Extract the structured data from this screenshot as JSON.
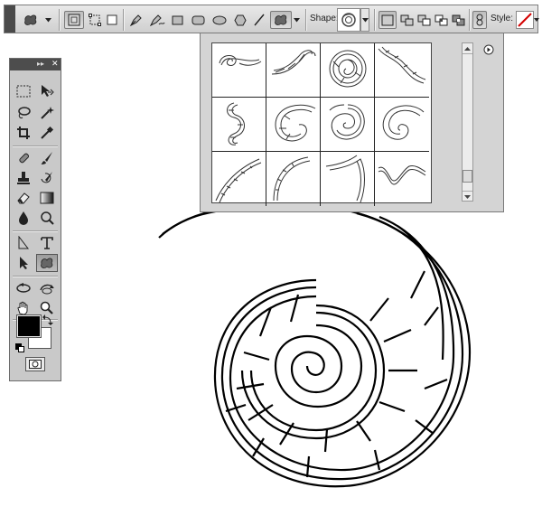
{
  "options_bar": {
    "shape_label": "Shape:",
    "style_label": "Style:",
    "tools": [
      "custom-shape-tool-preset",
      "shape-layers",
      "paths",
      "fill-pixels",
      "pen",
      "freeform-pen",
      "rectangle",
      "rounded-rectangle",
      "ellipse",
      "polygon",
      "line",
      "custom-shape"
    ],
    "style_color": "#d40000"
  },
  "tools_panel": {
    "title": "▸▸",
    "close": "✕",
    "foreground_color": "#000000",
    "background_color": "#ffffff"
  },
  "shape_picker": {
    "menu_icon": "circle-arrow-right-icon",
    "shapes": [
      "scroll-1",
      "scroll-2",
      "scroll-3",
      "scroll-4",
      "scroll-5",
      "scroll-6",
      "scroll-7",
      "scroll-8",
      "scroll-9",
      "scroll-10",
      "scroll-11",
      "scroll-12"
    ]
  }
}
